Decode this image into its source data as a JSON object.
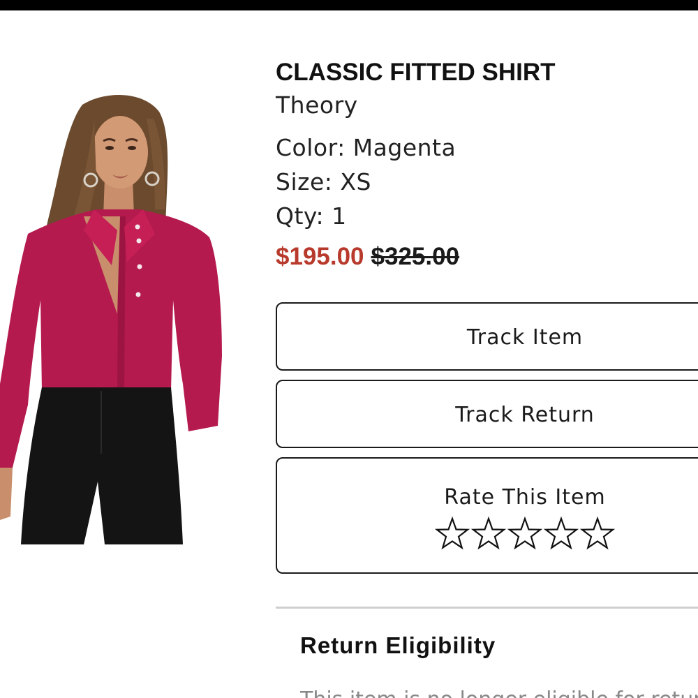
{
  "product": {
    "title": "CLASSIC FITTED SHIRT",
    "brand": "Theory",
    "color_line": "Color: Magenta",
    "size_line": "Size: XS",
    "qty_line": "Qty: 1",
    "sale_price": "$195.00",
    "original_price": "$325.00",
    "image_icon": "product-photo"
  },
  "actions": {
    "track_item": "Track Item",
    "track_return": "Track Return",
    "rate_item": "Rate This Item",
    "rating": {
      "value": 0,
      "max": 5,
      "icon": "star-outline-icon"
    }
  },
  "return_section": {
    "title": "Return Eligibility",
    "text": "This item is no longer eligible for return."
  },
  "colors": {
    "sale_price": "#b83a2c",
    "text": "#111111",
    "shirt": "#b51a4e"
  }
}
